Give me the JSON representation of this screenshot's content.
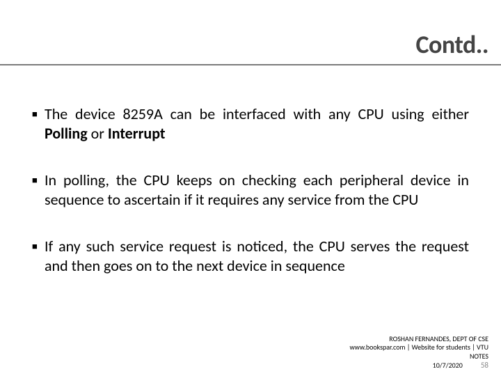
{
  "title": "Contd..",
  "bullets": [
    {
      "html": "The device 8259A can be interfaced with any CPU using either <strong>Polling</strong> or <strong>Interrupt</strong>"
    },
    {
      "html": "In polling, the CPU keeps on checking each peripheral device in sequence to ascertain if it requires any service from the CPU"
    },
    {
      "html": "If any such service request is noticed, the CPU serves the request and then goes on to the next device in sequence"
    }
  ],
  "footer": {
    "line1": "ROSHAN FERNANDES, DEPT OF CSE",
    "line2": "www.bookspar.com | Website for students | VTU",
    "line3": "NOTES",
    "date": "10/7/2020",
    "page": "58"
  }
}
